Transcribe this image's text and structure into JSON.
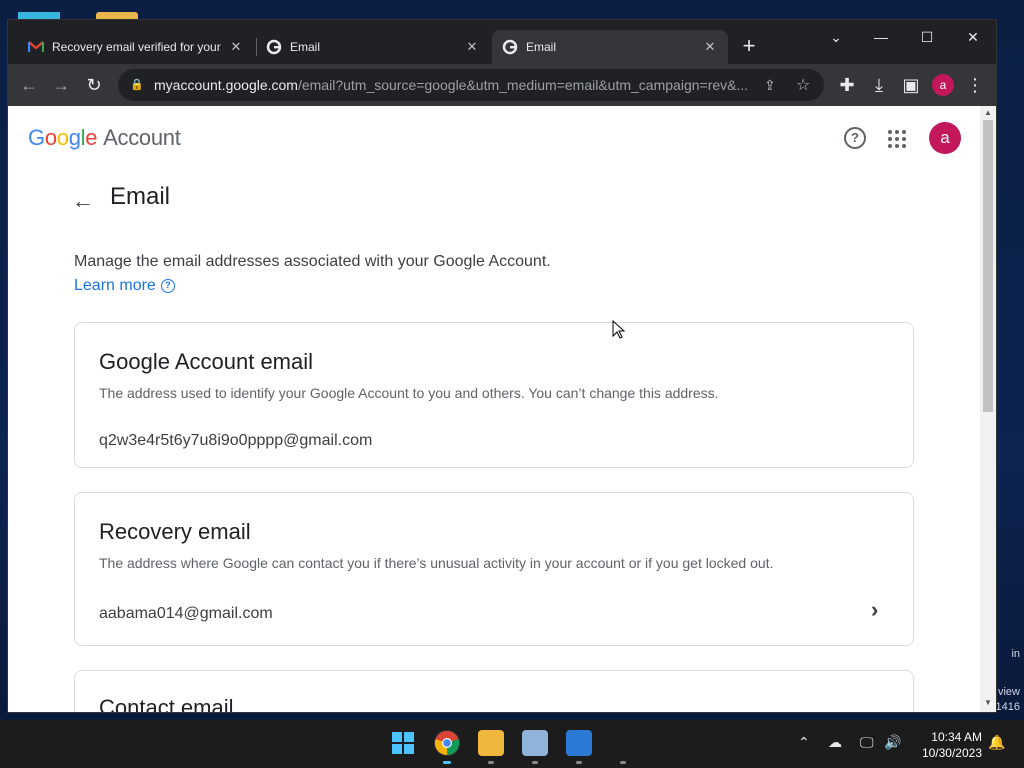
{
  "desktop": {
    "right_texts": [
      "in",
      "view",
      "1416"
    ]
  },
  "browser": {
    "tabs": [
      {
        "title": "Recovery email verified for your",
        "icon": "gmail-icon",
        "active": false
      },
      {
        "title": "Email",
        "icon": "google-g-icon",
        "active": false
      },
      {
        "title": "Email",
        "icon": "google-g-icon",
        "active": true
      }
    ],
    "url_host": "myaccount.google.com",
    "url_path": "/email?utm_source=google&utm_medium=email&utm_campaign=rev&...",
    "profile_initial": "a"
  },
  "header": {
    "logo_google": "Google",
    "logo_account": "Account",
    "avatar_initial": "a"
  },
  "main": {
    "title": "Email",
    "description": "Manage the email addresses associated with your Google Account.",
    "learn_more": "Learn more",
    "cards": [
      {
        "title": "Google Account email",
        "subtitle": "The address used to identify your Google Account to you and others. You can’t change this address.",
        "value": "q2w3e4r5t6y7u8i9o0pppp@gmail.com"
      },
      {
        "title": "Recovery email",
        "subtitle": "The address where Google can contact you if there’s unusual activity in your account or if you get locked out.",
        "value": "aabama014@gmail.com"
      },
      {
        "title": "Contact email"
      }
    ]
  },
  "taskbar": {
    "time": "10:34 AM",
    "date": "10/30/2023"
  },
  "colors": {
    "accent": "#1a73e8",
    "avatar": "#c2185b"
  }
}
